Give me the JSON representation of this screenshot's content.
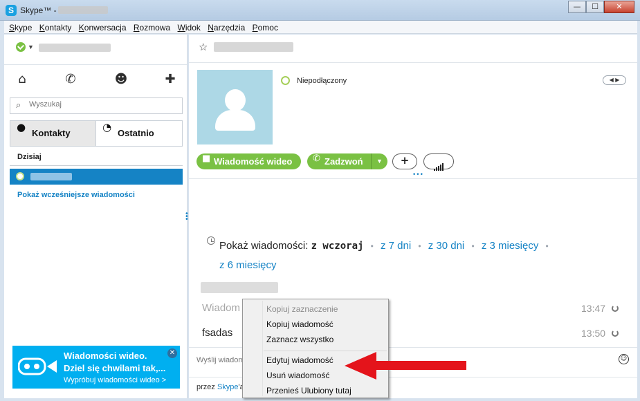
{
  "window": {
    "title": "Skype™ - "
  },
  "menu": [
    "Skype",
    "Kontakty",
    "Konwersacja",
    "Rozmowa",
    "Widok",
    "Narzędzia",
    "Pomoc"
  ],
  "window_buttons": {
    "minimize": "—",
    "maximize": "☐",
    "close": "✕"
  },
  "sidebar": {
    "search_placeholder": "Wyszukaj",
    "tabs": [
      "Kontakty",
      "Ostatnio"
    ],
    "section_today": "Dzisiaj",
    "show_earlier": "Pokaż wcześniejsze wiadomości",
    "icons": [
      "home-icon",
      "phone-icon",
      "group-icon",
      "add-contact-icon"
    ]
  },
  "promo": {
    "line1": "Wiadomości wideo.",
    "line2": "Dziel się chwilami tak,...",
    "link": "Wypróbuj wiadomości wideo >"
  },
  "contact": {
    "status": "Niepodłączony",
    "buttons": {
      "video": "Wiadomość wideo",
      "call": "Zadzwoń",
      "add": "+"
    }
  },
  "history": {
    "label": "Pokaż wiadomości:",
    "current": "z wczoraj",
    "options": [
      "z 7 dni",
      "z 30 dni",
      "z 3 miesięcy",
      "z 6 miesięcy"
    ]
  },
  "messages": [
    {
      "text": "Wiadom",
      "time": "13:47",
      "state": "pending"
    },
    {
      "text": "fsadas",
      "time": "13:50",
      "state": "pending"
    }
  ],
  "compose": {
    "placeholder": "Wyślij wiadom"
  },
  "footer": {
    "prefix": "przez ",
    "link": "Skype",
    "suffix": "'a"
  },
  "context_menu": {
    "items": [
      {
        "label": "Kopiuj zaznaczenie",
        "enabled": false
      },
      {
        "label": "Kopiuj wiadomość",
        "enabled": true
      },
      {
        "label": "Zaznacz wszystko",
        "enabled": true
      },
      {
        "label": "Edytuj wiadomość",
        "enabled": true
      },
      {
        "label": "Usuń wiadomość",
        "enabled": true
      },
      {
        "label": "Przenieś Ulubiony tutaj",
        "enabled": true
      }
    ]
  },
  "colors": {
    "accent_blue": "#1583c5",
    "skype_blue": "#00aff0",
    "green": "#7ac143",
    "arrow_red": "#e4141b"
  }
}
